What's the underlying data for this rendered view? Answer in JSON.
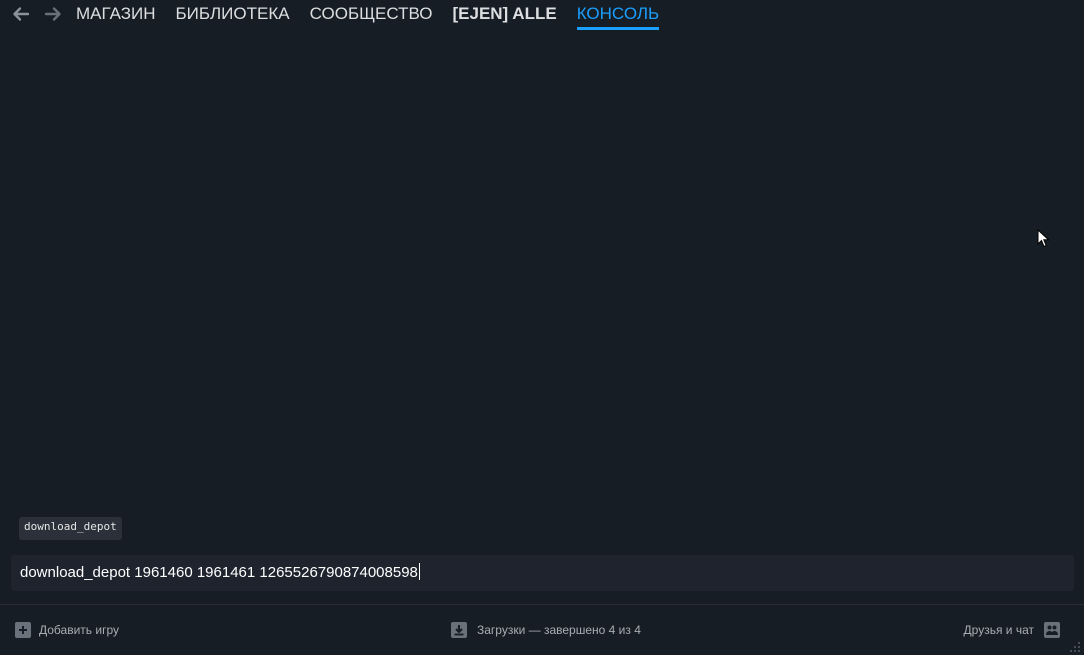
{
  "nav": {
    "tabs": [
      {
        "label": "МАГАЗИН"
      },
      {
        "label": "БИБЛИОТЕКА"
      },
      {
        "label": "СООБЩЕСТВО"
      },
      {
        "label": "[EJEN] ALLE"
      },
      {
        "label": "КОНСОЛЬ"
      }
    ],
    "active_tab": "КОНСОЛЬ",
    "back_icon": "arrow-left-icon",
    "forward_icon": "arrow-right-icon"
  },
  "console": {
    "autocomplete_suggestion": "download_depot",
    "input_value": "download_depot 1961460 1961461 1265526790874008598"
  },
  "bottombar": {
    "add_game_label": "Добавить игру",
    "add_game_icon": "plus-square-icon",
    "downloads_label": "Загрузки — завершено 4 из 4",
    "downloads_icon": "download-icon",
    "friends_label": "Друзья и чат",
    "friends_icon": "friends-icon"
  },
  "colors": {
    "background": "#171d25",
    "accent": "#1a9fff",
    "nav_text": "#dcdedf",
    "input_bg": "#1f232d",
    "muted_text": "#a9adb3"
  }
}
